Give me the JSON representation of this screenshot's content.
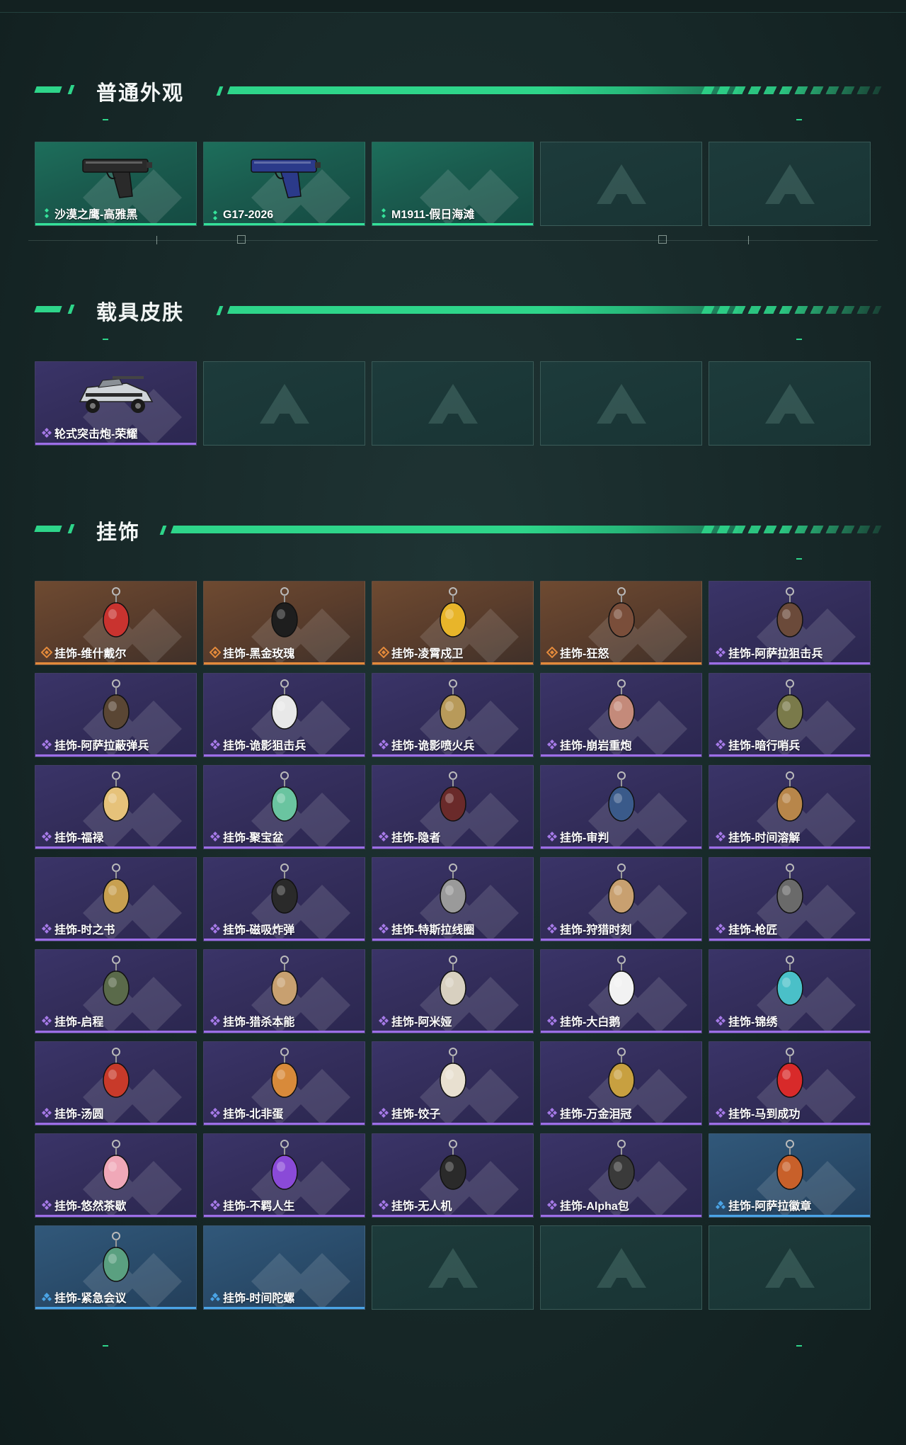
{
  "sections": {
    "skins": {
      "title": "普通外观",
      "items": [
        {
          "label": "沙漠之鹰-高雅黑",
          "rarity": "green",
          "icon": "pistol-icon",
          "color": "#2a2a2a"
        },
        {
          "label": "G17-2026",
          "rarity": "green",
          "icon": "pistol-icon",
          "color": "#2b3a8a"
        },
        {
          "label": "M1911-假日海滩",
          "rarity": "green",
          "icon": "",
          "color": ""
        },
        {
          "label": "",
          "rarity": "empty"
        },
        {
          "label": "",
          "rarity": "empty"
        }
      ]
    },
    "vehicle": {
      "title": "载具皮肤",
      "items": [
        {
          "label": "轮式突击炮-荣耀",
          "rarity": "purple",
          "icon": "vehicle-icon"
        },
        {
          "label": "",
          "rarity": "empty"
        },
        {
          "label": "",
          "rarity": "empty"
        },
        {
          "label": "",
          "rarity": "empty"
        },
        {
          "label": "",
          "rarity": "empty"
        }
      ]
    },
    "charms": {
      "title": "挂饰",
      "items": [
        {
          "label": "挂饰-维什戴尔",
          "rarity": "orange",
          "color": "#c9332f"
        },
        {
          "label": "挂饰-黑金玫瑰",
          "rarity": "orange",
          "color": "#1e1e1e"
        },
        {
          "label": "挂饰-凌霄戍卫",
          "rarity": "orange",
          "color": "#e8b52a"
        },
        {
          "label": "挂饰-狂怒",
          "rarity": "orange",
          "color": "#7a4e3a"
        },
        {
          "label": "挂饰-阿萨拉狙击兵",
          "rarity": "purple",
          "color": "#6b4a3a"
        },
        {
          "label": "挂饰-阿萨拉蔽弹兵",
          "rarity": "purple",
          "color": "#5a4634"
        },
        {
          "label": "挂饰-诡影狙击兵",
          "rarity": "purple",
          "color": "#e8e8e8"
        },
        {
          "label": "挂饰-诡影喷火兵",
          "rarity": "purple",
          "color": "#b89a5a"
        },
        {
          "label": "挂饰-崩岩重炮",
          "rarity": "purple",
          "color": "#c48a7a"
        },
        {
          "label": "挂饰-暗行哨兵",
          "rarity": "purple",
          "color": "#7a7a4a"
        },
        {
          "label": "挂饰-福禄",
          "rarity": "purple",
          "color": "#e6c27a"
        },
        {
          "label": "挂饰-聚宝盆",
          "rarity": "purple",
          "color": "#6ac4a0"
        },
        {
          "label": "挂饰-隐者",
          "rarity": "purple",
          "color": "#6a2a2a"
        },
        {
          "label": "挂饰-审判",
          "rarity": "purple",
          "color": "#3a5a8a"
        },
        {
          "label": "挂饰-时间溶解",
          "rarity": "purple",
          "color": "#b8864a"
        },
        {
          "label": "挂饰-时之书",
          "rarity": "purple",
          "color": "#c8a050"
        },
        {
          "label": "挂饰-磁吸炸弹",
          "rarity": "purple",
          "color": "#2a2a2a"
        },
        {
          "label": "挂饰-特斯拉线圈",
          "rarity": "purple",
          "color": "#9a9a9a"
        },
        {
          "label": "挂饰-狩猎时刻",
          "rarity": "purple",
          "color": "#c8a070"
        },
        {
          "label": "挂饰-枪匠",
          "rarity": "purple",
          "color": "#6a6a6a"
        },
        {
          "label": "挂饰-启程",
          "rarity": "purple",
          "color": "#5a6a4a"
        },
        {
          "label": "挂饰-猎杀本能",
          "rarity": "purple",
          "color": "#c8a070"
        },
        {
          "label": "挂饰-阿米娅",
          "rarity": "purple",
          "color": "#d8d0c0"
        },
        {
          "label": "挂饰-大白鹅",
          "rarity": "purple",
          "color": "#f2f2f2"
        },
        {
          "label": "挂饰-锦绣",
          "rarity": "purple",
          "color": "#4ac0c8"
        },
        {
          "label": "挂饰-汤圆",
          "rarity": "purple",
          "color": "#c83a2a"
        },
        {
          "label": "挂饰-北非蛋",
          "rarity": "purple",
          "color": "#d88a3a"
        },
        {
          "label": "挂饰-饺子",
          "rarity": "purple",
          "color": "#e8e0d0"
        },
        {
          "label": "挂饰-万金泪冠",
          "rarity": "purple",
          "color": "#c8a040"
        },
        {
          "label": "挂饰-马到成功",
          "rarity": "purple",
          "color": "#d82a2a"
        },
        {
          "label": "挂饰-悠然茶歇",
          "rarity": "purple",
          "color": "#f0a8b8"
        },
        {
          "label": "挂饰-不羁人生",
          "rarity": "purple",
          "color": "#8a4ad8"
        },
        {
          "label": "挂饰-无人机",
          "rarity": "purple",
          "color": "#2a2a2a"
        },
        {
          "label": "挂饰-Alpha包",
          "rarity": "purple",
          "color": "#3a3a3a"
        },
        {
          "label": "挂饰-阿萨拉徽章",
          "rarity": "blue",
          "color": "#c8602a"
        },
        {
          "label": "挂饰-紧急会议",
          "rarity": "blue",
          "color": "#5aa080"
        },
        {
          "label": "挂饰-时间陀螺",
          "rarity": "blue",
          "color": ""
        },
        {
          "label": "",
          "rarity": "empty"
        },
        {
          "label": "",
          "rarity": "empty"
        },
        {
          "label": "",
          "rarity": "empty"
        }
      ]
    }
  },
  "colors": {
    "accent_green": "#2ed58a",
    "rarity_green": "#35e29a",
    "rarity_purple": "#9c6ee6",
    "rarity_orange": "#e48a3b",
    "rarity_blue": "#4aa4e6"
  }
}
